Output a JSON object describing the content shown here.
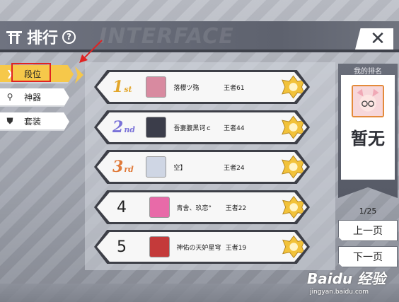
{
  "header": {
    "title": "排行",
    "watermark": "INTERFACE",
    "help_symbol": "?",
    "close_symbol": "✕"
  },
  "sidebar": {
    "items": [
      {
        "label": "段位",
        "icon": "chevron-icon",
        "active": true
      },
      {
        "label": "神器",
        "icon": "pin-icon",
        "active": false
      },
      {
        "label": "套装",
        "icon": "shield-icon",
        "active": false
      }
    ]
  },
  "ranking": {
    "rows": [
      {
        "rank": "1",
        "suffix": "st",
        "rank_color": "#e2a62a",
        "name": "落櫻ツ殇",
        "level": "王者61",
        "avatar_color": "#d88aa0"
      },
      {
        "rank": "2",
        "suffix": "nd",
        "rank_color": "#7a72d8",
        "name": "吾妻腹黑诃ｃ",
        "level": "王者44",
        "avatar_color": "#3b3d4a"
      },
      {
        "rank": "3",
        "suffix": "rd",
        "rank_color": "#e07a3a",
        "name": "空】",
        "level": "王者24",
        "avatar_color": "#cfd6e4"
      },
      {
        "rank": "4",
        "suffix": "",
        "rank_color": "#222222",
        "name": "青舍、玖恋°",
        "level": "王者22",
        "avatar_color": "#e86aa8"
      },
      {
        "rank": "5",
        "suffix": "",
        "rank_color": "#222222",
        "name": "神佑の天妒星穹",
        "level": "王者19",
        "avatar_color": "#c43a3a"
      }
    ]
  },
  "my_rank": {
    "title": "我的排名",
    "value": "暂无"
  },
  "pagination": {
    "indicator": "1/25",
    "prev_label": "上一页",
    "next_label": "下一页"
  },
  "watermark_badge": {
    "logo": "Baidu 经验",
    "url": "jingyan.baidu.com"
  },
  "colors": {
    "accent": "#f6c84a",
    "highlight": "#e02222",
    "header": "#5e626e"
  }
}
